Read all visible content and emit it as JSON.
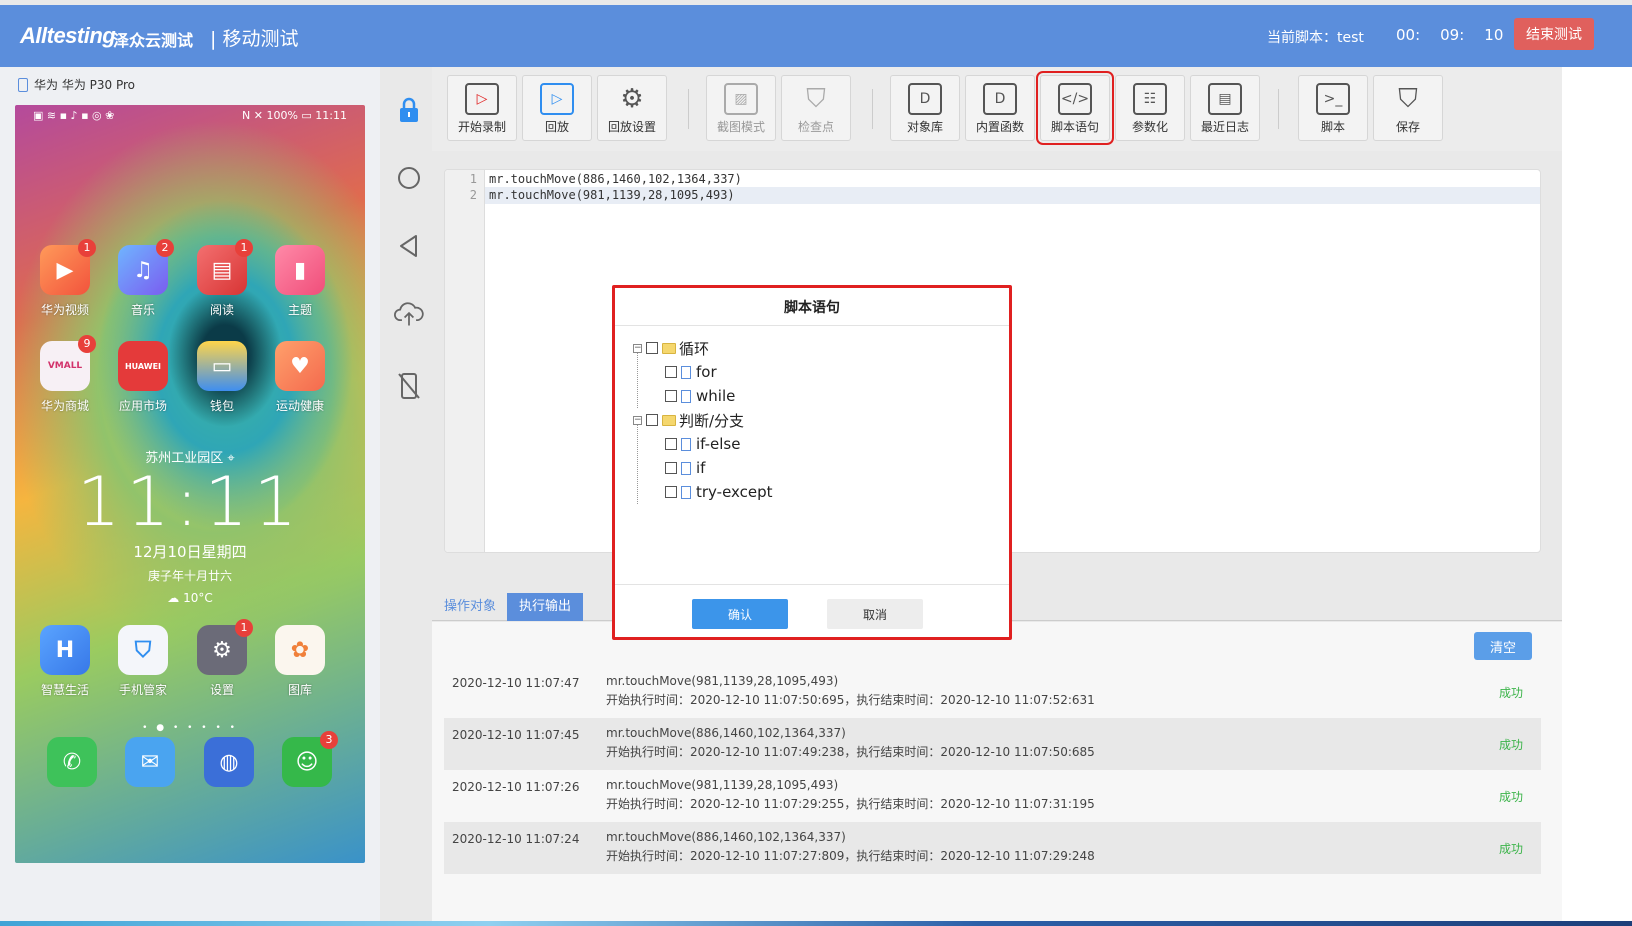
{
  "header": {
    "logo": "Alltesting",
    "logo_sub": "泽众云测试",
    "module": "| 移动测试",
    "current_script": "当前脚本：test",
    "timer": {
      "h": "00:",
      "m": "09:",
      "s": "10"
    },
    "end_button": "结束测试",
    "bg_color": "#5b8edc",
    "end_color": "#e0605d"
  },
  "device": {
    "name": "华为 华为 P30 Pro",
    "status_right": "N ✕ 100% ▭ 11:11",
    "apps_row1": [
      {
        "label": "华为视频",
        "badge": "1",
        "icon": "video-play-icon"
      },
      {
        "label": "音乐",
        "badge": "2",
        "icon": "music-note-icon"
      },
      {
        "label": "阅读",
        "badge": "1",
        "icon": "book-icon"
      },
      {
        "label": "主题",
        "badge": "",
        "icon": "paint-brush-icon"
      }
    ],
    "apps_row2": [
      {
        "label": "华为商城",
        "badge": "9",
        "icon": "vmall-bag-icon",
        "text": "VMALL"
      },
      {
        "label": "应用市场",
        "badge": "",
        "icon": "huawei-logo-icon",
        "text": "HUAWEI"
      },
      {
        "label": "钱包",
        "badge": "",
        "icon": "wallet-icon"
      },
      {
        "label": "运动健康",
        "badge": "",
        "icon": "heart-icon"
      }
    ],
    "location": "苏州工业园区",
    "clock": "11:11",
    "date": "12月10日星期四",
    "lunar": "庚子年十月廿六",
    "weather": "10°C",
    "apps_row3": [
      {
        "label": "智慧生活",
        "badge": "",
        "icon": "smart-life-icon"
      },
      {
        "label": "手机管家",
        "badge": "",
        "icon": "shield-icon"
      },
      {
        "label": "设置",
        "badge": "1",
        "icon": "settings-gear-icon"
      },
      {
        "label": "图库",
        "badge": "",
        "icon": "gallery-flower-icon"
      }
    ],
    "dock": [
      {
        "icon": "phone-icon",
        "badge": ""
      },
      {
        "icon": "message-icon",
        "badge": ""
      },
      {
        "icon": "browser-icon",
        "badge": ""
      },
      {
        "icon": "wechat-icon",
        "badge": "3"
      }
    ]
  },
  "toolbar": {
    "start_record": "开始录制",
    "replay": "回放",
    "replay_settings": "回放设置",
    "screenshot_mode": "截图模式",
    "checkpoint": "检查点",
    "object_lib": "对象库",
    "builtin_func": "内置函数",
    "script_statement": "脚本语句",
    "parameterize": "参数化",
    "recent_log": "最近日志",
    "script": "脚本",
    "save": "保存"
  },
  "editor": {
    "lines": [
      {
        "n": "1",
        "code": "mr.touchMove(886,1460,102,1364,337)"
      },
      {
        "n": "2",
        "code": "mr.touchMove(981,1139,28,1095,493)"
      }
    ]
  },
  "tabs": {
    "objects": "操作对象",
    "output": "执行输出"
  },
  "output": {
    "clear": "清空",
    "rows": [
      {
        "time": "2020-12-10 11:07:47",
        "cmd": "mr.touchMove(981,1139,28,1095,493)",
        "detail": "开始执行时间：2020-12-10 11:07:50:695，执行结束时间：2020-12-10 11:07:52:631",
        "status": "成功"
      },
      {
        "time": "2020-12-10 11:07:45",
        "cmd": "mr.touchMove(886,1460,102,1364,337)",
        "detail": "开始执行时间：2020-12-10 11:07:49:238，执行结束时间：2020-12-10 11:07:50:685",
        "status": "成功"
      },
      {
        "time": "2020-12-10 11:07:26",
        "cmd": "mr.touchMove(981,1139,28,1095,493)",
        "detail": "开始执行时间：2020-12-10 11:07:29:255，执行结束时间：2020-12-10 11:07:31:195",
        "status": "成功"
      },
      {
        "time": "2020-12-10 11:07:24",
        "cmd": "mr.touchMove(886,1460,102,1364,337)",
        "detail": "开始执行时间：2020-12-10 11:07:27:809，执行结束时间：2020-12-10 11:07:29:248",
        "status": "成功"
      }
    ]
  },
  "dialog": {
    "title": "脚本语句",
    "tree": {
      "loop": "循环",
      "for": "for",
      "while": "while",
      "branch": "判断/分支",
      "if_else": "if-else",
      "if": "if",
      "try": "try-except"
    },
    "ok": "确认",
    "cancel": "取消"
  }
}
